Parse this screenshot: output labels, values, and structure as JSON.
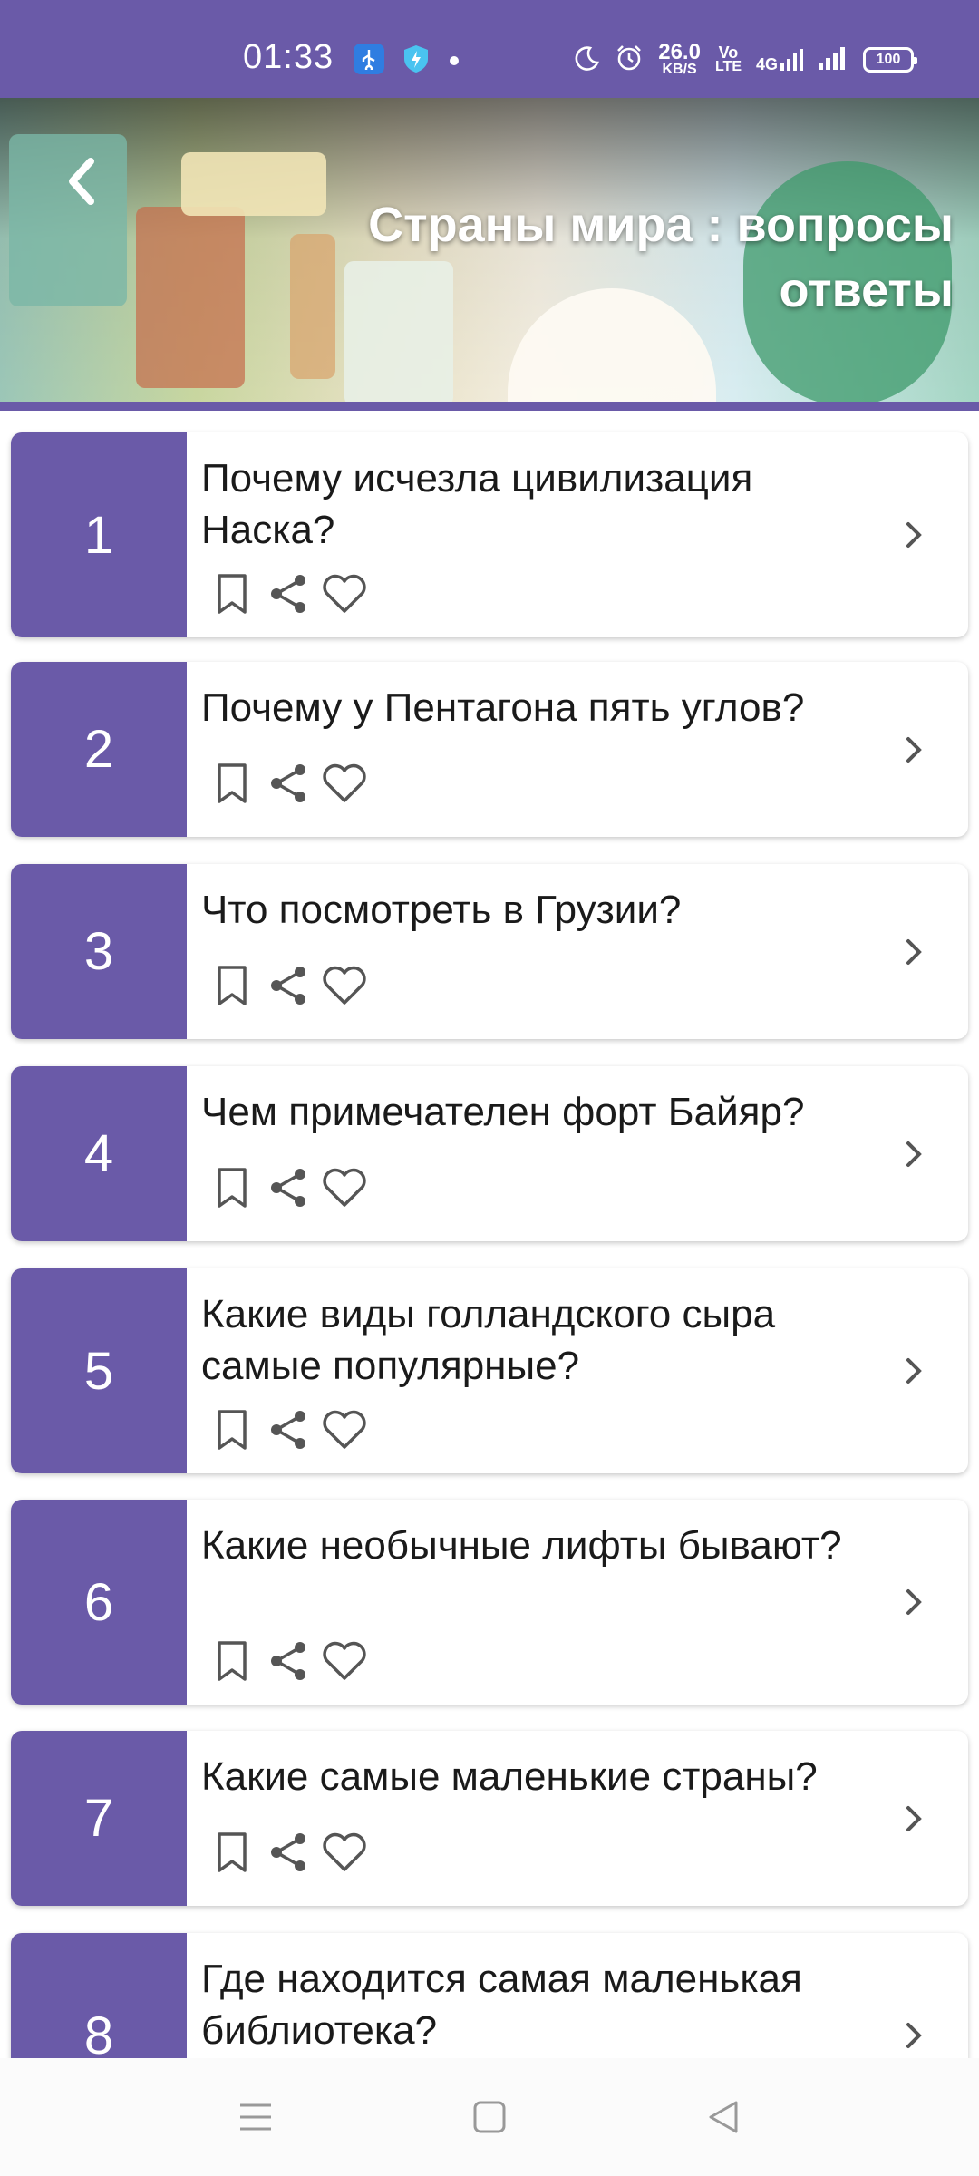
{
  "status_bar": {
    "time": "01:33",
    "net_speed_value": "26.0",
    "net_speed_unit": "KB/S",
    "volte_line1": "Vo",
    "volte_line2": "LTE",
    "network": "4G",
    "battery": "100",
    "icons": [
      "usb-icon",
      "shield-icon",
      "moon-icon",
      "alarm-icon",
      "signal-icon"
    ]
  },
  "header": {
    "title": "Страны мира : вопросы ответы",
    "back_icon": "chevron-left-icon"
  },
  "colors": {
    "accent": "#6a5aa8",
    "text": "#1a1a1a",
    "icon": "#555555"
  },
  "questions": [
    {
      "number": "1",
      "text": "Почему исчезла цивилизация Наска?"
    },
    {
      "number": "2",
      "text": "Почему у Пентагона пять углов?"
    },
    {
      "number": "3",
      "text": "Что посмотреть в Грузии?"
    },
    {
      "number": "4",
      "text": "Чем примечателен форт Байяр?"
    },
    {
      "number": "5",
      "text": "Какие виды голландского сыра самые популярные?"
    },
    {
      "number": "6",
      "text": "Какие необычные лифты бывают?"
    },
    {
      "number": "7",
      "text": "Какие самые маленькие страны?"
    },
    {
      "number": "8",
      "text": "Где находится самая маленькая библиотека?"
    }
  ],
  "card_icons": [
    "bookmark-icon",
    "share-icon",
    "heart-icon",
    "chevron-right-icon"
  ],
  "nav": [
    "menu-icon",
    "home-icon",
    "back-icon"
  ]
}
